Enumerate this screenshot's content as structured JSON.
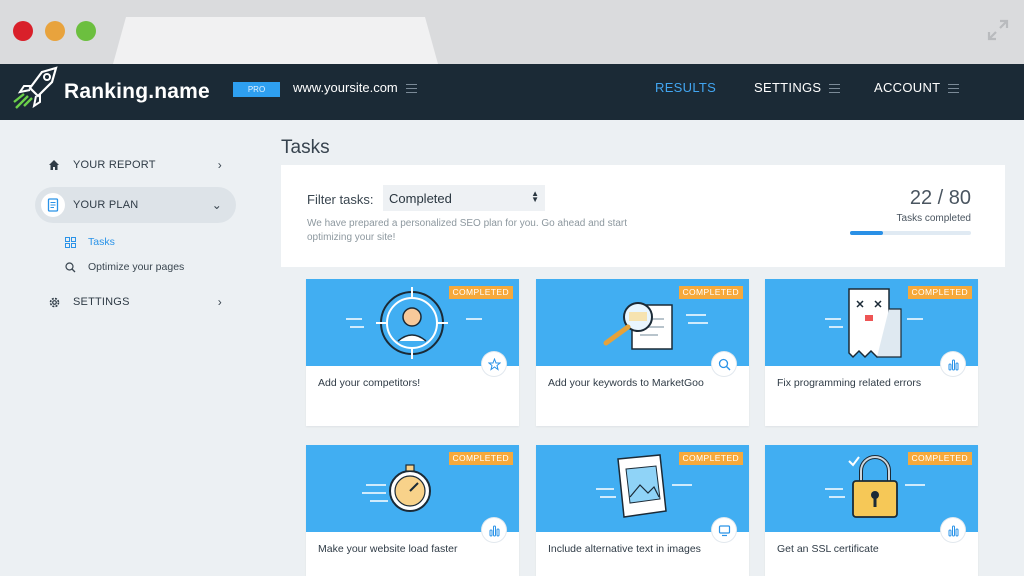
{
  "app": {
    "brand": "Ranking.name",
    "plan_badge": "PRO",
    "site": "www.yoursite.com"
  },
  "nav": {
    "results": "RESULTS",
    "settings": "SETTINGS",
    "account": "ACCOUNT"
  },
  "sidebar": {
    "items": [
      {
        "label": "YOUR REPORT",
        "icon": "home-icon"
      },
      {
        "label": "YOUR PLAN",
        "icon": "document-icon"
      },
      {
        "label": "SETTINGS",
        "icon": "gear-icon"
      }
    ],
    "subitems": [
      {
        "label": "Tasks",
        "icon": "grid-icon"
      },
      {
        "label": "Optimize your pages",
        "icon": "search-icon"
      }
    ]
  },
  "main": {
    "title": "Tasks",
    "filter_label": "Filter tasks:",
    "filter_value": "Completed",
    "description": "We have prepared a personalized SEO plan for you. Go ahead and start optimizing your site!",
    "done_count": "22",
    "total_count": "80",
    "count_separator": " / ",
    "count_label": "Tasks completed",
    "progress": 0.275
  },
  "cards": [
    {
      "badge": "COMPLETED",
      "title": "Add your competitors!",
      "illustration": "competitor-target-icon",
      "icon": "star-icon"
    },
    {
      "badge": "COMPLETED",
      "title": "Add your keywords to MarketGoo",
      "illustration": "keyword-magnifier-icon",
      "icon": "search-icon"
    },
    {
      "badge": "COMPLETED",
      "title": "Fix programming related errors",
      "illustration": "error-page-icon",
      "icon": "bar-chart-icon"
    },
    {
      "badge": "COMPLETED",
      "title": "Make your website load faster",
      "illustration": "stopwatch-icon",
      "icon": "bar-chart-icon"
    },
    {
      "badge": "COMPLETED",
      "title": "Include alternative text in images",
      "illustration": "image-file-icon",
      "icon": "monitor-icon"
    },
    {
      "badge": "COMPLETED",
      "title": "Get an SSL certificate",
      "illustration": "padlock-icon",
      "icon": "bar-chart-icon"
    }
  ],
  "colors": {
    "header_bg": "#1b2a36",
    "accent": "#2a90e6",
    "card_top": "#41aef2",
    "badge": "#f6a93b"
  }
}
